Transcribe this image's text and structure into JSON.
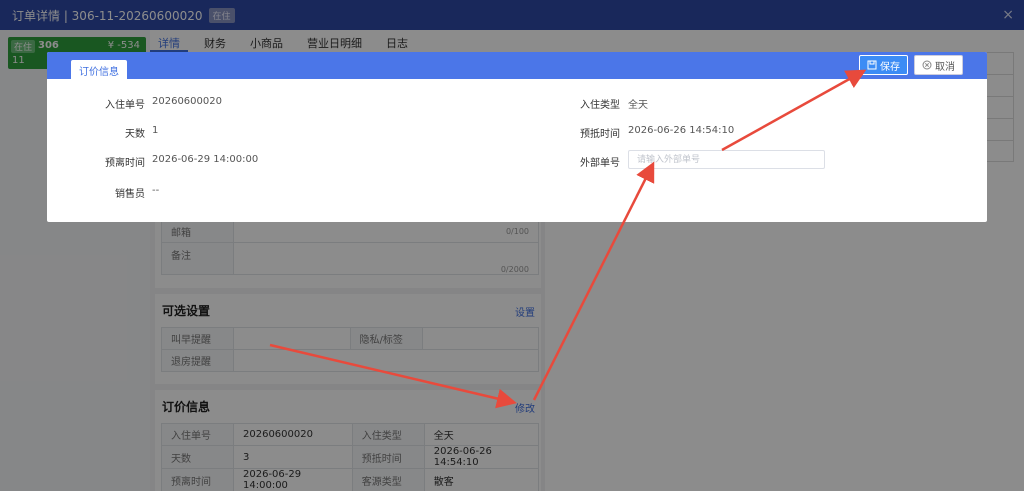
{
  "header": {
    "title": "订单详情 | 306-11-20260600020",
    "status_badge": "在住",
    "close": "×"
  },
  "room_card": {
    "status": "在住",
    "room_no": "306",
    "amount": "¥ -534",
    "count": "11"
  },
  "tabs": [
    "详情",
    "财务",
    "小商品",
    "营业日明细",
    "日志"
  ],
  "bg": {
    "email_label": "邮箱",
    "email_count": "0/100",
    "remark_label": "备注",
    "remark_count": "0/2000",
    "optional_title": "可选设置",
    "optional_link": "设置",
    "wake_label": "叫早提醒",
    "privacy_label": "隐私/标签",
    "checkout_label": "退房提醒",
    "price_title": "订价信息",
    "price_link": "修改",
    "rows": [
      {
        "k1": "入住单号",
        "v1": "20260600020",
        "k2": "入住类型",
        "v2": "全天"
      },
      {
        "k1": "天数",
        "v1": "3",
        "k2": "预抵时间",
        "v2": "2026-06-26 14:54:10"
      },
      {
        "k1": "预离时间",
        "v1": "2026-06-29 14:00:00",
        "k2": "客源类型",
        "v2": "散客"
      }
    ]
  },
  "modal": {
    "tab": "订价信息",
    "save": "保存",
    "cancel": "取消",
    "checkin_no_label": "入住单号",
    "checkin_no": "20260600020",
    "days_label": "天数",
    "days": "1",
    "checkout_label": "预离时间",
    "checkout": "2026-06-29 14:00:00",
    "sales_label": "销售员",
    "sales": "--",
    "type_label": "入住类型",
    "type": "全天",
    "arrival_label": "预抵时间",
    "arrival": "2026-06-26 14:54:10",
    "ext_label": "外部单号",
    "ext_placeholder": "请输入外部单号"
  },
  "colors": {
    "header": "#2f4aa6",
    "modal_head": "#4b76e8",
    "accent": "#3f6fe0",
    "arrow": "#e84a3c",
    "room_green": "#2e9e3c"
  }
}
